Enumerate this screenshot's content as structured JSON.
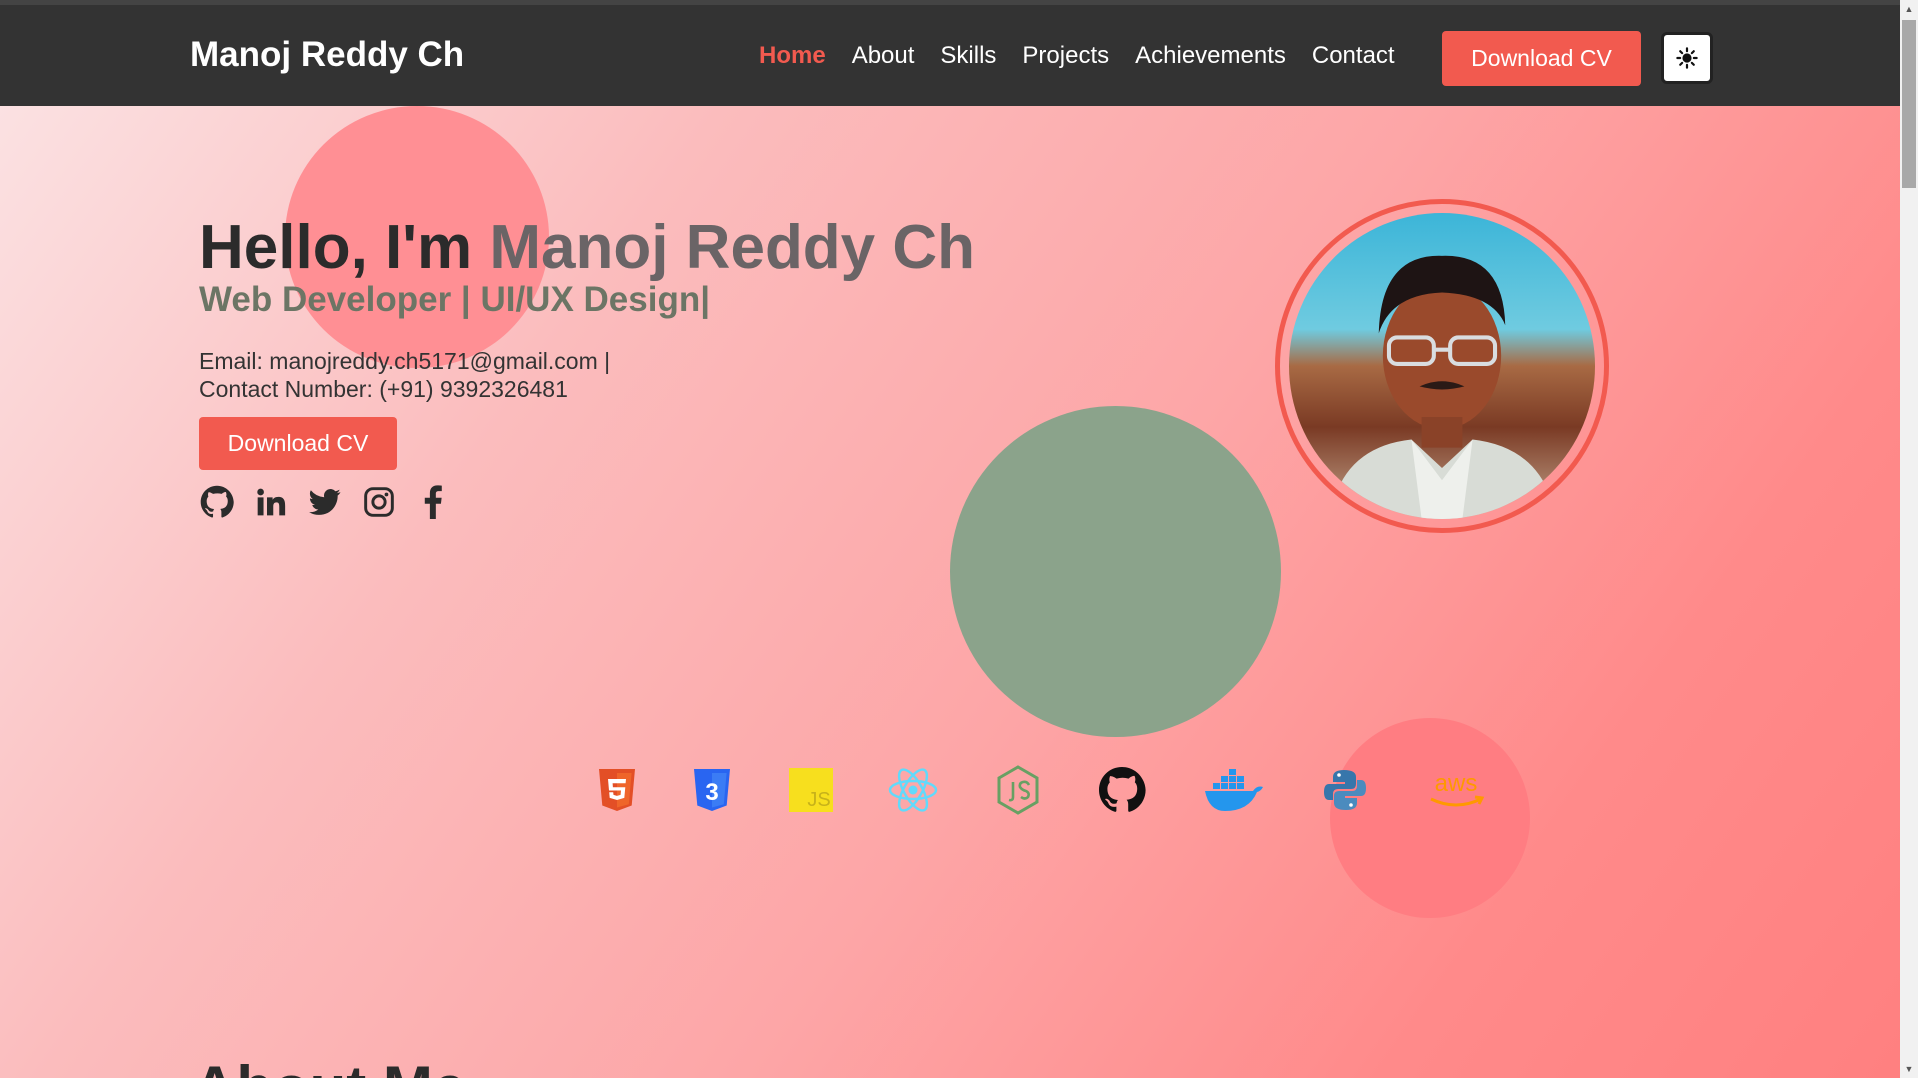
{
  "nav": {
    "brand": "Manoj Reddy Ch",
    "links": [
      "Home",
      "About",
      "Skills",
      "Projects",
      "Achievements",
      "Contact"
    ],
    "active": "Home",
    "download_cv": "Download CV",
    "theme_icon": "sun-icon"
  },
  "hero": {
    "greeting": "Hello, I'm ",
    "name": "Manoj Reddy Ch",
    "subtitle": "Web Developer | UI/UX Design|",
    "email_line": "Email: manojreddy.ch5171@gmail.com |",
    "phone_line": "Contact Number: (+91) 9392326481",
    "download_cv": "Download CV",
    "socials": [
      "github-icon",
      "linkedin-icon",
      "twitter-icon",
      "instagram-icon",
      "facebook-icon"
    ]
  },
  "tech_icons": [
    "html5-icon",
    "css3-icon",
    "javascript-icon",
    "react-icon",
    "nodejs-icon",
    "github-icon",
    "docker-icon",
    "python-icon",
    "aws-icon"
  ],
  "tech_labels": {
    "css": "3",
    "js": "JS",
    "aws": "aws"
  },
  "about": {
    "heading": "About Me"
  },
  "colors": {
    "accent": "#f25a4f",
    "navbar": "#333333",
    "subtitle": "#6c7565",
    "blob_green": "#8ba38b"
  }
}
